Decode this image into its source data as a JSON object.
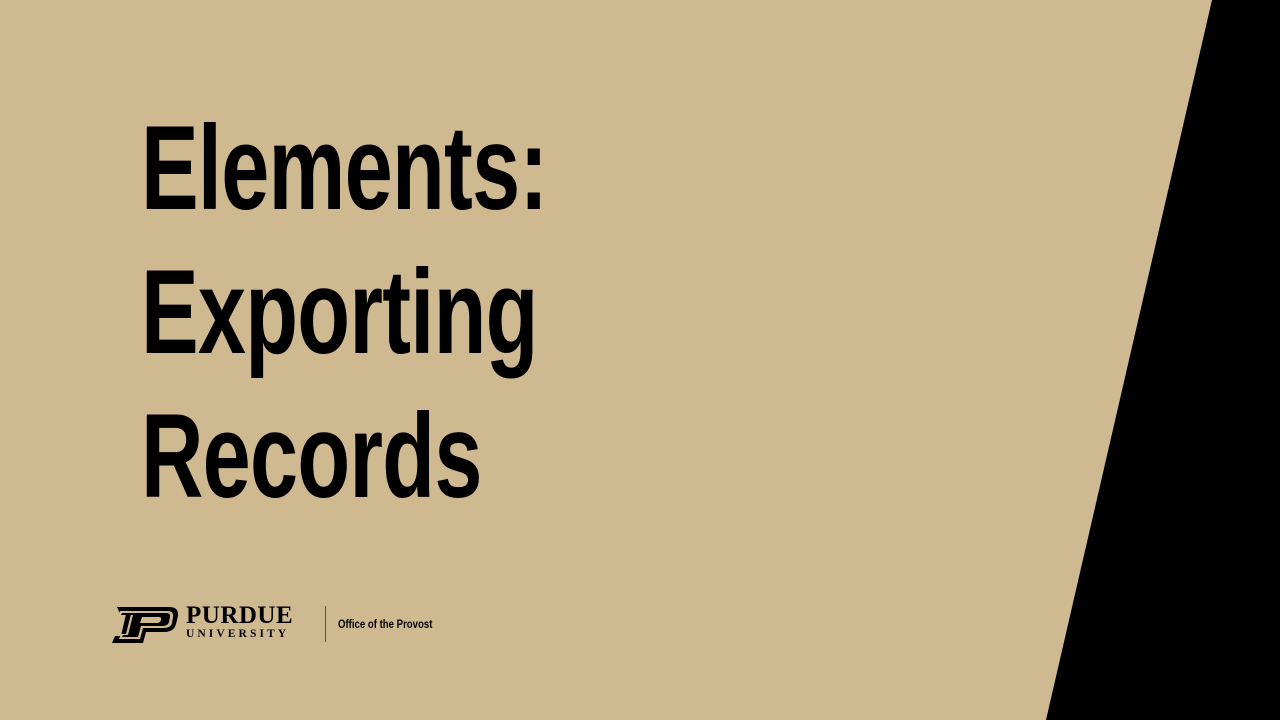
{
  "slide": {
    "title_lines": [
      "Elements:",
      "Exporting",
      "Records"
    ],
    "colors": {
      "background": "#CFB991",
      "wedge": "#000000",
      "text": "#000000"
    }
  },
  "footer": {
    "logo_icon": "purdue-p-icon",
    "wordmark_primary": "PURDUE",
    "wordmark_secondary": "UNIVERSITY",
    "unit_name": "Office of the Provost"
  }
}
